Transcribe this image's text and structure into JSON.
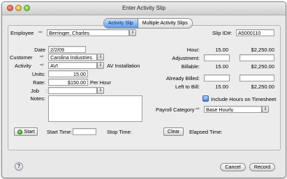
{
  "window": {
    "title": "Enter Activity Slip"
  },
  "tabs": [
    {
      "label": "Activity Slip"
    },
    {
      "label": "Multiple Activity Slips"
    }
  ],
  "employee": {
    "label": "Employee",
    "value": "Berringer, Charles"
  },
  "slip": {
    "label": "Slip ID#:",
    "value": "A5000110"
  },
  "date": {
    "label": "Date",
    "value": "2/2/09"
  },
  "customer": {
    "label": "Customer",
    "value": "Carolina Industries"
  },
  "activity": {
    "label": "Activity",
    "value": "AVI",
    "description": "AV Installation"
  },
  "units": {
    "label": "Units:",
    "value": "15.00"
  },
  "rate": {
    "label": "Rate:",
    "value": "$150.00",
    "unit": "Per Hour"
  },
  "job": {
    "label": "Job",
    "value": ""
  },
  "notes": {
    "label": "Notes:",
    "value": ""
  },
  "summary": {
    "hour": {
      "label": "Hour:",
      "units": "15.00",
      "amount": "$2,250.00"
    },
    "adjustment": {
      "label": "Adjustment:",
      "units": "",
      "amount": ""
    },
    "billable": {
      "label": "Billable:",
      "units": "15.00",
      "amount": "$2,250.00"
    },
    "already_billed": {
      "label": "Already Billed:",
      "units": "",
      "amount": ""
    },
    "left_to_bill": {
      "label": "Left to Bill:",
      "units": "15.00",
      "amount": "$2,250.00"
    }
  },
  "timesheet": {
    "label": "Include Hours on Timesheet",
    "checked": true
  },
  "payroll": {
    "label": "Payroll Category",
    "value": "Base Hourly"
  },
  "timer": {
    "start_label": "Start",
    "start_time_label": "Start Time:",
    "start_time_value": "",
    "stop_time_label": "Stop Time:",
    "clear_label": "Clear",
    "elapsed_label": "Elapsed Time:"
  },
  "footer": {
    "help_icon": "?",
    "cancel_label": "Cancel",
    "record_label": "Record"
  },
  "glyphs": {
    "popup_arrow": "⇳",
    "lookup_arrow": "⇨",
    "check": "✓"
  }
}
